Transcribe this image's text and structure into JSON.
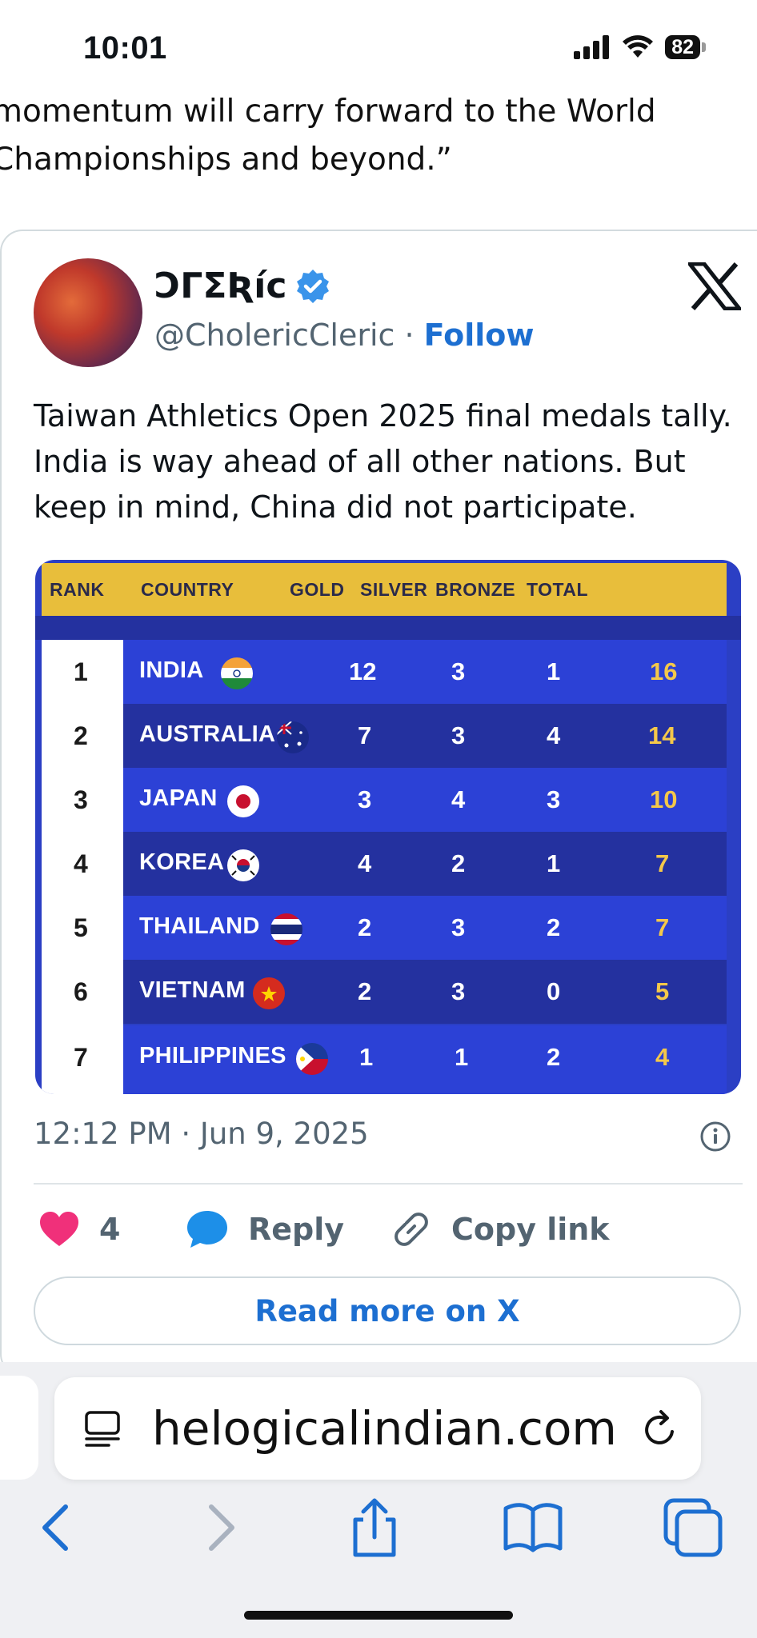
{
  "status_bar": {
    "time": "10:01",
    "battery": "82"
  },
  "article": {
    "line1": "momentum will carry forward to the World",
    "line2": "Championships and beyond.”"
  },
  "tweet": {
    "display_name": "ƆΓΣƦíc",
    "handle": "@CholericCleric",
    "separator": " · ",
    "follow_label": "Follow",
    "text": "Taiwan Athletics Open 2025 final medals tally. India is way ahead of all other nations. But keep in mind, China did not participate.",
    "timestamp": "12:12 PM · Jun 9, 2025",
    "likes_count": "4",
    "reply_label": "Reply",
    "copy_link_label": "Copy link",
    "read_more_label": "Read more on X"
  },
  "medal_table": {
    "headers": {
      "rank": "RANK",
      "country": "COUNTRY",
      "gold": "GOLD",
      "silver": "SILVER",
      "bronze": "BRONZE",
      "total": "TOTAL"
    },
    "rows": [
      {
        "rank": "1",
        "country": "INDIA",
        "flag": "flag-india-icon",
        "gold": "12",
        "silver": "3",
        "bronze": "1",
        "total": "16"
      },
      {
        "rank": "2",
        "country": "AUSTRALIA",
        "flag": "flag-australia-icon",
        "gold": "7",
        "silver": "3",
        "bronze": "4",
        "total": "14"
      },
      {
        "rank": "3",
        "country": "JAPAN",
        "flag": "flag-japan-icon",
        "gold": "3",
        "silver": "4",
        "bronze": "3",
        "total": "10"
      },
      {
        "rank": "4",
        "country": "KOREA",
        "flag": "flag-korea-icon",
        "gold": "4",
        "silver": "2",
        "bronze": "1",
        "total": "7"
      },
      {
        "rank": "5",
        "country": "THAILAND",
        "flag": "flag-thailand-icon",
        "gold": "2",
        "silver": "3",
        "bronze": "2",
        "total": "7"
      },
      {
        "rank": "6",
        "country": "VIETNAM",
        "flag": "flag-vietnam-icon",
        "gold": "2",
        "silver": "3",
        "bronze": "0",
        "total": "5"
      },
      {
        "rank": "7",
        "country": "PHILIPPINES",
        "flag": "flag-philippines-icon",
        "gold": "1",
        "silver": "1",
        "bronze": "2",
        "total": "4"
      }
    ]
  },
  "browser": {
    "address": "helogicalindian.com"
  },
  "colors": {
    "accent": "#1d6fd1",
    "like": "#f0307a",
    "gold_bar": "#e8be3b",
    "table_blue": "#2b3fc4",
    "table_dark": "#24319f"
  }
}
